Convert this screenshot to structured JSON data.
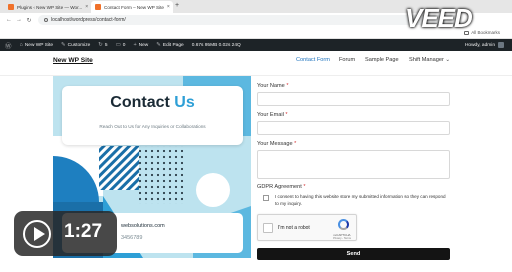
{
  "browser": {
    "tabs": [
      {
        "title": "Plugins ‹ New WP Site — Wor..."
      },
      {
        "title": "Contact Form – New WP Site"
      }
    ],
    "new_tab_symbol": "+",
    "close_symbol": "×",
    "url": "localhost/wordpress/contact-form/",
    "all_bookmarks": "All Bookmarks",
    "nav_icons": [
      "back-arrow-icon",
      "forward-arrow-icon",
      "reload-icon"
    ]
  },
  "watermark": "VEED",
  "admin_bar": {
    "site": "New WP Site",
    "customize": "Customize",
    "comments": "5",
    "updates": "0",
    "new": "New",
    "edit_page": "Edit Page",
    "stats": "0.67s  95MB  0.02s  24Q",
    "howdy": "Howdy, admin"
  },
  "site": {
    "title": "New WP Site",
    "nav": [
      "Contact Form",
      "Forum",
      "Sample Page",
      "Shift Manager"
    ]
  },
  "hero": {
    "title_main": "Contact",
    "title_accent": "Us",
    "subtitle": "Reach Out to Us for Any Inquiries or Collaborations",
    "contact_line_1": "websolutions.com",
    "contact_line_2": "3456789"
  },
  "form": {
    "name_label": "Your Name",
    "email_label": "Your Email",
    "message_label": "Your Message",
    "required_mark": "*",
    "gdpr_label": "GDPR Agreement",
    "gdpr_text": "I consent to having this website store my submitted information so they can respond to my inquiry.",
    "recaptcha_label": "I'm not a robot",
    "recaptcha_brand": "reCAPTCHA",
    "recaptcha_terms": "Privacy - Terms",
    "send_label": "Send"
  },
  "player": {
    "time": "1:27"
  },
  "colors": {
    "accent": "#2e9fd6",
    "admin_bar": "#1d2327",
    "hero_bg": "#bde3ef",
    "button": "#141414"
  }
}
